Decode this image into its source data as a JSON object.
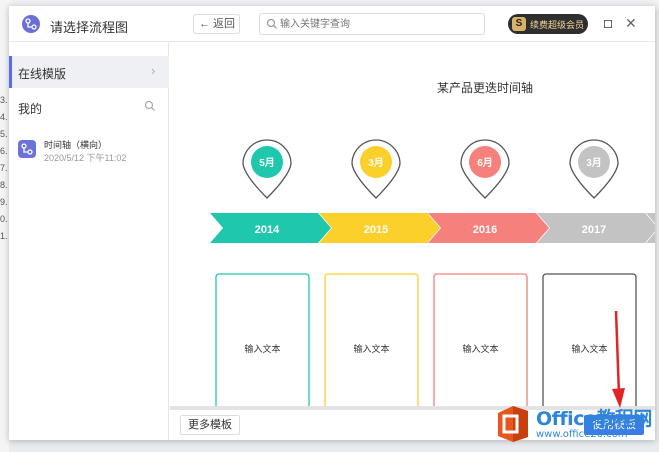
{
  "dialog": {
    "title": "请选择流程图",
    "back_label": "返回",
    "search_placeholder": "输入关键字查询",
    "vip_badge": "S",
    "vip_label": "续费超级会员"
  },
  "sidebar": {
    "online_label": "在线模版",
    "mine_label": "我的",
    "files": [
      {
        "name": "时间轴（横向）",
        "date": "2020/5/12 下午11:02"
      }
    ]
  },
  "timeline": {
    "title": "某产品更迭时间轴",
    "text_placeholder": "输入文本",
    "items": [
      {
        "month": "5月",
        "year": "2014",
        "color": "#1fc8ad"
      },
      {
        "month": "3月",
        "year": "2015",
        "color": "#fcd02b"
      },
      {
        "month": "6月",
        "year": "2016",
        "color": "#f6807c"
      },
      {
        "month": "3月",
        "year": "2017",
        "color": "#c3c3c3"
      }
    ]
  },
  "bottom": {
    "more_label": "更多模板",
    "use_label": "使用模板"
  },
  "watermark": {
    "brand": "Office教程网",
    "url": "www.office26.com"
  },
  "background": {
    "row_numbers": [
      "3.",
      "4.",
      "5.",
      "6.",
      "7.",
      "8.",
      "9.",
      "0.",
      "1."
    ]
  }
}
